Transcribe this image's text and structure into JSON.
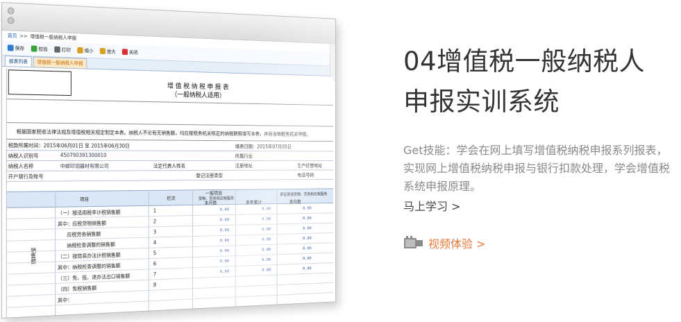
{
  "screenshot": {
    "breadcrumb": [
      "首页",
      ">>",
      "增值税一般纳税人申报"
    ],
    "toolbar": [
      {
        "label": "保存",
        "icon": "save-icon",
        "color": "#2e7bd0"
      },
      {
        "label": "校验",
        "icon": "check-icon",
        "color": "#3aa33a"
      },
      {
        "label": "打印",
        "icon": "print-icon",
        "color": "#666666"
      },
      {
        "label": "缩小",
        "icon": "zoom-out-icon",
        "color": "#d8a020"
      },
      {
        "label": "放大",
        "icon": "zoom-in-icon",
        "color": "#d8a020"
      },
      {
        "label": "关闭",
        "icon": "close-icon",
        "color": "#d83030"
      }
    ],
    "tabs": [
      "报表列表",
      "增值税一般纳税人申报"
    ],
    "form": {
      "title_line1": "增 值 税 纳 税 申 报 表",
      "title_line2": "（一般纳税人适用）",
      "note": "根据国家税收法律法规及增值税相关规定制定本表。纳税人不论有无销售额，均应按税务机关核定的纳税期限填写本表，并向当地税务机关申报。",
      "period_label": "税款所属时间：2015年06月01日 至 2015年06月30日",
      "fill_date_label": "填表日期：2015年07月05日",
      "taxpayer_id_label": "纳税人识别号",
      "taxpayer_id_value": "450790391300010",
      "industry_label": "所属行业",
      "taxpayer_name_label": "纳税人名称",
      "taxpayer_name_value": "中邮印润器材有限公司",
      "legal_rep_label": "法定代表人姓名",
      "reg_address_label": "注册地址",
      "biz_address_label": "生产经营地址",
      "bank_label": "开户银行及账号",
      "reg_type_label": "登记注册类型",
      "phone_label": "电话号码",
      "col_item": "项目",
      "col_no": "栏次",
      "col_general": "一般项目",
      "col_general_sub": "货物、劳务和应税服务",
      "col_current": "本月数",
      "col_ytd": "本年累计",
      "col_refund": "即征即退货物、劳务和应税服务",
      "col_refund_current": "本月数",
      "side_label": "销售额",
      "rows": [
        {
          "name": "（一）按适用税率计税销售额",
          "no": "1",
          "v1": "0.00",
          "v2": "0.00",
          "v3": "0.00"
        },
        {
          "name": "其中：应税货物销售额",
          "no": "2",
          "v1": "0.00",
          "v2": "0.00",
          "v3": "0.00"
        },
        {
          "name": "应税劳务销售额",
          "no": "3",
          "v1": "0.00",
          "v2": "0.00",
          "v3": "0.00"
        },
        {
          "name": "纳税检查调整的销售额",
          "no": "4",
          "v1": "0.00",
          "v2": "0.00",
          "v3": "0.00"
        },
        {
          "name": "（二）按简易办法计税销售额",
          "no": "5",
          "v1": "0.00",
          "v2": "0.00",
          "v3": "0.00"
        },
        {
          "name": "其中：纳税检查调整的销售额",
          "no": "6",
          "v1": "0.00",
          "v2": "0.00",
          "v3": "0.00"
        },
        {
          "name": "（三）免、抵、退办法出口销售额",
          "no": "7",
          "v1": "0.00",
          "v2": "0.00",
          "v3": "0.00"
        },
        {
          "name": "（四）免税销售额",
          "no": "8",
          "v1": "",
          "v2": "",
          "v3": ""
        },
        {
          "name": "其中：",
          "no": "",
          "v1": "",
          "v2": "",
          "v3": ""
        }
      ]
    }
  },
  "heading": {
    "line1": "04增值税一般纳税人",
    "line2": "申报实训系统"
  },
  "description": "Get技能：学会在网上填写增值税纳税申报系列报表，实现网上增值税纳税申报与银行扣款处理，学会增值税系统申报原理。",
  "more_link": "马上学习 >",
  "video_link": "视频体验 >",
  "colors": {
    "heading": "#333333",
    "description": "#8a8a8a",
    "accent": "#e8793b"
  }
}
